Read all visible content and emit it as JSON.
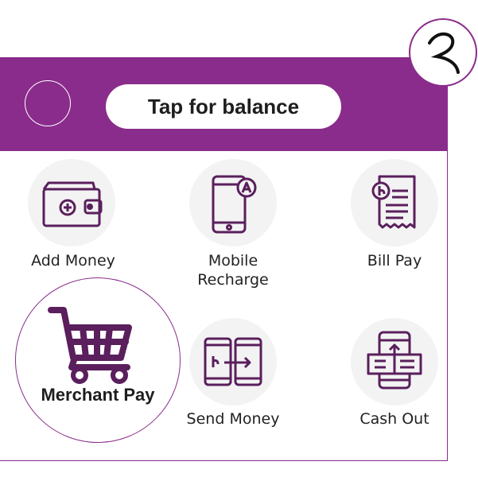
{
  "header": {
    "balance_label": "Tap for balance"
  },
  "services": {
    "add_money": "Add Money",
    "mobile_recharge_line1": "Mobile",
    "mobile_recharge_line2": "Recharge",
    "bill_pay": "Bill Pay",
    "merchant_pay": "Merchant Pay",
    "send_money": "Send Money",
    "cash_out": "Cash Out"
  },
  "colors": {
    "brand": "#8a2c8c",
    "icon": "#5a1f5c",
    "tile_bg": "#f3f3f3",
    "text": "#222222"
  }
}
